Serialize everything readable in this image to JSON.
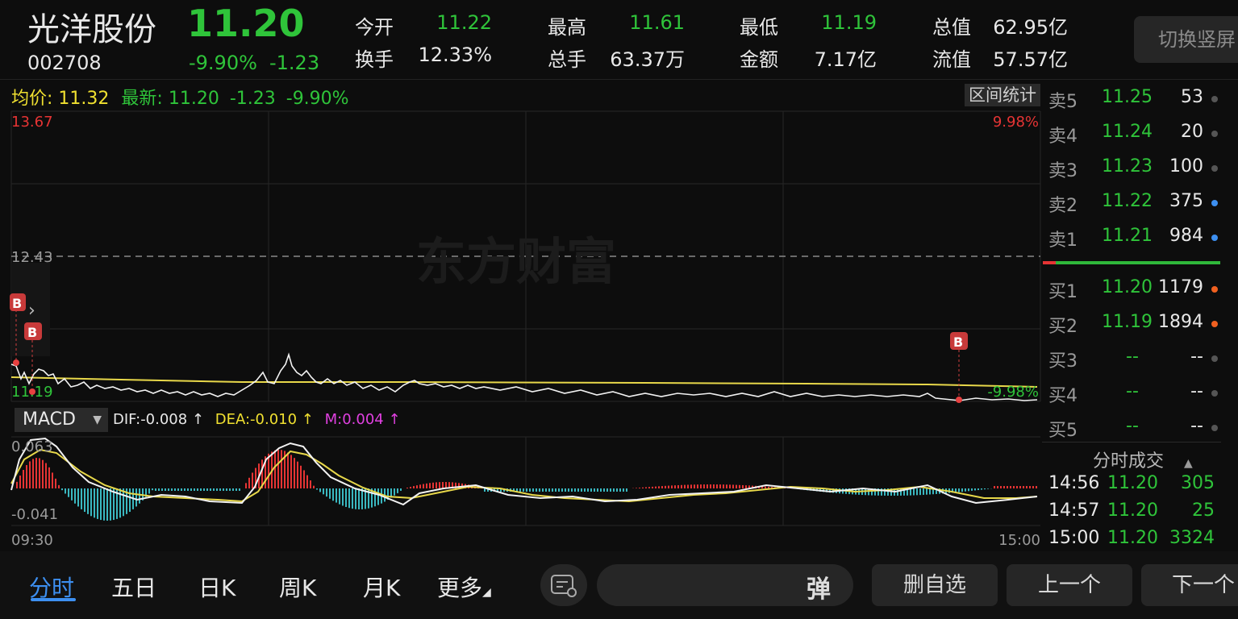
{
  "header": {
    "stock_name": "光洋股份",
    "price": "11.20",
    "code": "002708",
    "change_pct": "-9.90%",
    "change_amt": "-1.23",
    "stats": [
      {
        "label": "今开",
        "value": "11.22",
        "color": "#2fc43a"
      },
      {
        "label": "最高",
        "value": "11.61",
        "color": "#2fc43a"
      },
      {
        "label": "最低",
        "value": "11.19",
        "color": "#2fc43a"
      },
      {
        "label": "总值",
        "value": "62.95亿",
        "color": "#e8e8e8"
      },
      {
        "label": "换手",
        "value": "12.33%",
        "color": "#e8e8e8"
      },
      {
        "label": "总手",
        "value": "63.37万",
        "color": "#e8e8e8"
      },
      {
        "label": "金额",
        "value": "7.17亿",
        "color": "#e8e8e8"
      },
      {
        "label": "流值",
        "value": "57.57亿",
        "color": "#e8e8e8"
      }
    ],
    "switch_button": "切换竖屏"
  },
  "info_line": {
    "avg_label": "均价:",
    "avg_value": "11.32",
    "latest_label": "最新:",
    "latest_value": "11.20",
    "latest_chg": "-1.23",
    "latest_pct": "-9.90%",
    "range_stats_button": "区间统计"
  },
  "main_chart": {
    "y_top_label": "13.67",
    "y_mid_label": "12.43",
    "y_bottom_label": "11.19",
    "pct_top_label": "9.98%",
    "pct_bottom_label": "-9.98%",
    "watermark": "东方财富",
    "buy_marker": "B",
    "time_start": "09:30",
    "time_end": "15:00"
  },
  "macd": {
    "selector_label": "MACD",
    "dif": "DIF:-0.008 ↑",
    "dea": "DEA:-0.010 ↑",
    "m": "M:0.004 ↑",
    "y_top_label": "0.063",
    "y_bottom_label": "-0.041"
  },
  "order_book": {
    "sell": [
      {
        "label": "卖5",
        "price": "11.25",
        "volume": "53",
        "dot": "#555555"
      },
      {
        "label": "卖4",
        "price": "11.24",
        "volume": "20",
        "dot": "#555555"
      },
      {
        "label": "卖3",
        "price": "11.23",
        "volume": "100",
        "dot": "#555555"
      },
      {
        "label": "卖2",
        "price": "11.22",
        "volume": "375",
        "dot": "#3d8ff0"
      },
      {
        "label": "卖1",
        "price": "11.21",
        "volume": "984",
        "dot": "#3d8ff0"
      }
    ],
    "buy": [
      {
        "label": "买1",
        "price": "11.20",
        "volume": "1179",
        "dot": "#f06020"
      },
      {
        "label": "买2",
        "price": "11.19",
        "volume": "1894",
        "dot": "#f06020"
      },
      {
        "label": "买3",
        "price": "--",
        "volume": "--",
        "dot": "#555555"
      },
      {
        "label": "买4",
        "price": "--",
        "volume": "--",
        "dot": "#555555"
      },
      {
        "label": "买5",
        "price": "--",
        "volume": "--",
        "dot": "#555555"
      }
    ]
  },
  "trades": {
    "header": "分时成交",
    "rows": [
      {
        "time": "14:56",
        "price": "11.20",
        "volume": "305"
      },
      {
        "time": "14:57",
        "price": "11.20",
        "volume": "25"
      },
      {
        "time": "15:00",
        "price": "11.20",
        "volume": "3324"
      }
    ]
  },
  "bottom_nav": {
    "tabs": [
      "分时",
      "五日",
      "日K",
      "周K",
      "月K",
      "更多"
    ],
    "danmu_icon": "弹",
    "remove_watchlist": "删自选",
    "prev": "上一个",
    "next": "下一个"
  }
}
